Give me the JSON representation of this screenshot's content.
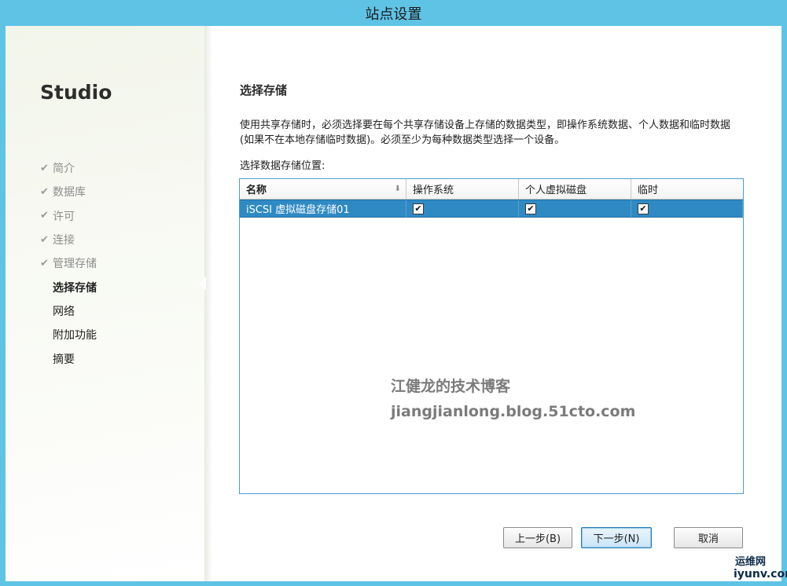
{
  "window": {
    "title": "站点设置"
  },
  "sidebar": {
    "brand": "Studio",
    "steps": [
      {
        "label": "简介",
        "state": "done"
      },
      {
        "label": "数据库",
        "state": "done"
      },
      {
        "label": "许可",
        "state": "done"
      },
      {
        "label": "连接",
        "state": "done"
      },
      {
        "label": "管理存储",
        "state": "done"
      },
      {
        "label": "选择存储",
        "state": "current"
      },
      {
        "label": "网络",
        "state": "todo"
      },
      {
        "label": "附加功能",
        "state": "todo"
      },
      {
        "label": "摘要",
        "state": "todo"
      }
    ],
    "done_icon": "checkmark-icon"
  },
  "main": {
    "title": "选择存储",
    "description": "使用共享存储时，必须选择要在每个共享存储设备上存储的数据类型，即操作系统数据、个人数据和临时数据(如果不在本地存储临时数据)。必须至少为每种数据类型选择一个设备。",
    "location_label": "选择数据存储位置:",
    "table": {
      "columns": [
        "名称",
        "操作系统",
        "个人虚拟磁盘",
        "临时"
      ],
      "sort_icon": "sort-down-icon",
      "rows": [
        {
          "name": "iSCSI 虚拟磁盘存储01",
          "os": true,
          "pvd": true,
          "temp": true
        }
      ]
    }
  },
  "watermark": {
    "line1": "江健龙的技术博客",
    "line2": "jiangjianlong.blog.51cto.com"
  },
  "buttons": {
    "prev": "上一步(B)",
    "next": "下一步(N)",
    "cancel": "取消"
  },
  "corner_logo": {
    "line1": "运维网",
    "line2": "iyunv.com"
  },
  "colors": {
    "frame": "#5fc3e6",
    "selection": "#2f8ac4",
    "grid_border": "#4b9ed0"
  }
}
